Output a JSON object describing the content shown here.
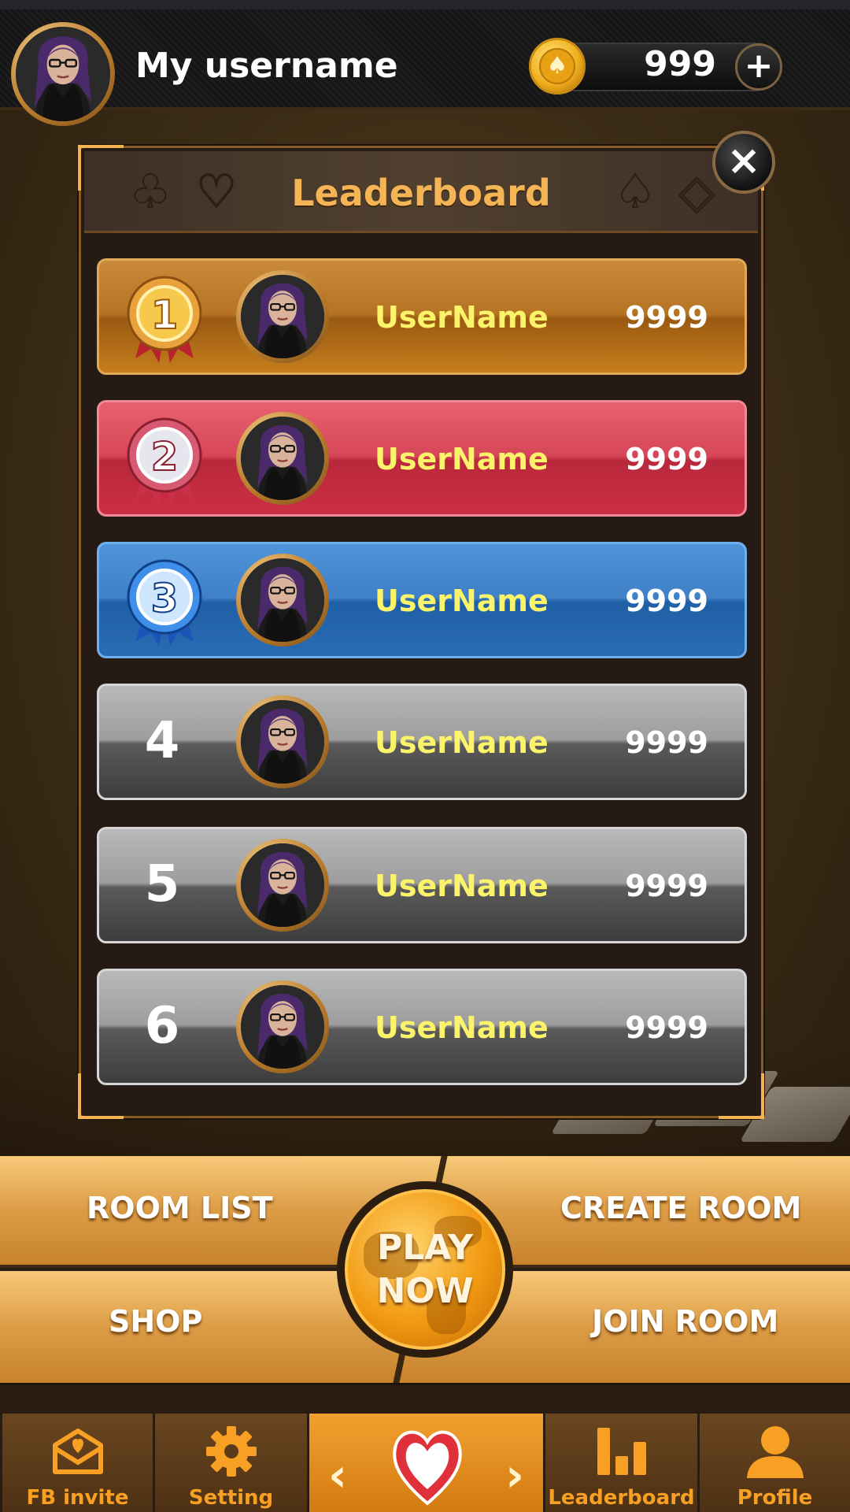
{
  "header": {
    "username": "My username",
    "coins": "999",
    "add_coins": "+",
    "avatar_icon": "player-avatar",
    "coin_icon": "spade-coin-icon"
  },
  "leaderboard": {
    "title": "Leaderboard",
    "close_label": "×",
    "suits": [
      "♣",
      "♡",
      "♠",
      "◇"
    ],
    "rows": [
      {
        "rank": "1",
        "name": "UserName",
        "score": "9999",
        "style": "gold"
      },
      {
        "rank": "2",
        "name": "UserName",
        "score": "9999",
        "style": "red"
      },
      {
        "rank": "3",
        "name": "UserName",
        "score": "9999",
        "style": "blue"
      },
      {
        "rank": "4",
        "name": "UserName",
        "score": "9999",
        "style": "grey"
      },
      {
        "rank": "5",
        "name": "UserName",
        "score": "9999",
        "style": "grey"
      },
      {
        "rank": "6",
        "name": "UserName",
        "score": "9999",
        "style": "grey"
      }
    ]
  },
  "menu": {
    "room_list": "ROOM LIST",
    "create_room": "CREATE ROOM",
    "shop": "SHOP",
    "join_room": "JOIN ROOM",
    "play_line1": "PLAY",
    "play_line2": "NOW"
  },
  "nav": {
    "fb_invite": "FB invite",
    "setting": "Setting",
    "leaderboard": "Leaderboard",
    "profile": "Profile",
    "prev": "‹",
    "next": "›",
    "center_icon": "heart-icon"
  },
  "colors": {
    "accent": "#f7a023",
    "gold_row": "#b57323",
    "red_row": "#d64658",
    "blue_row": "#3f80c7",
    "grey_row": "#6a6a6a",
    "name_text": "#fbf36a"
  }
}
